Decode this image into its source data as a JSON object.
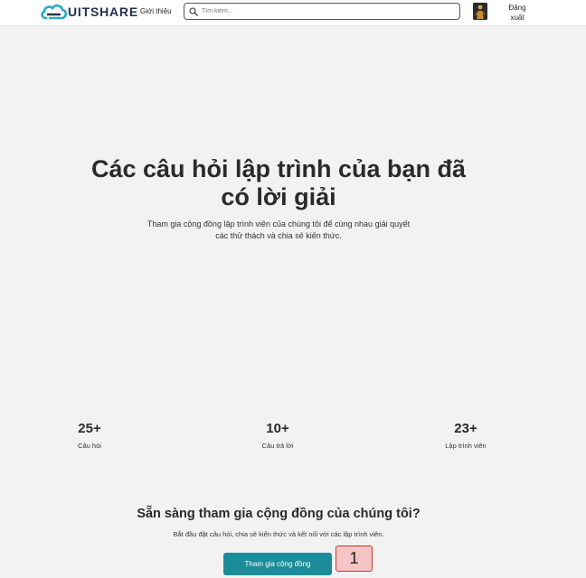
{
  "navbar": {
    "logo_text": "UITSHARE",
    "nav_about": "Giới thiệu",
    "search_placeholder": "Tìm kiếm...",
    "logout_line1": "Đăng",
    "logout_line2": "xuất"
  },
  "hero": {
    "title_line1": "Các câu hỏi lập trình của bạn đã",
    "title_line2": "có lời giải",
    "subtitle_line1": "Tham gia cộng đồng lập trình viên của chúng tôi để cùng nhau giải quyết",
    "subtitle_line2": "các thử thách và chia sẻ kiến thức."
  },
  "stats": [
    {
      "value": "25+",
      "label": "Câu hỏi"
    },
    {
      "value": "10+",
      "label": "Câu trả lời"
    },
    {
      "value": "23+",
      "label": "Lập trình viên"
    }
  ],
  "cta": {
    "title": "Sẵn sàng tham gia cộng đồng của chúng tôi?",
    "subtitle": "Bắt đầu đặt câu hỏi, chia sẻ kiến thức và kết nối với các lập trình viên.",
    "button_label": "Tham gia cộng đồng",
    "marker_number": "1"
  },
  "colors": {
    "brand": "#22304a",
    "accent": "#1a8c99",
    "logo_cloud": "#2aa7c9",
    "background": "#f2f2f2",
    "marker_fill": "#f6c4c4"
  },
  "icons": {
    "logo": "cloud-logo-icon",
    "search": "search-icon",
    "avatar": "user-avatar"
  }
}
